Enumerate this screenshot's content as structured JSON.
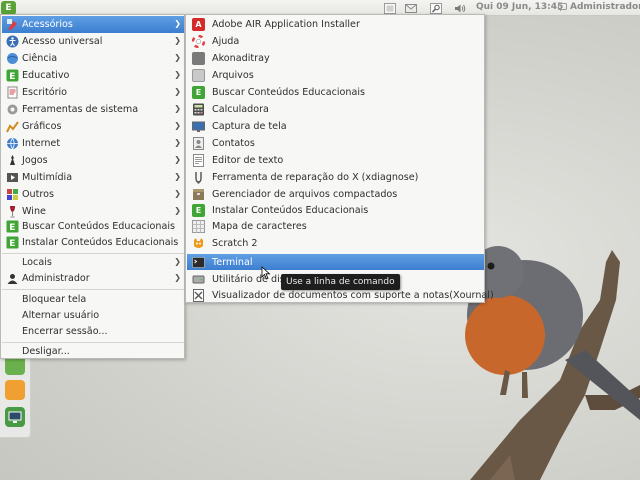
{
  "top_panel": {
    "menu_button_icon": "ubuntu-edu-menu-icon",
    "clock": "Qui 09 Jun, 13:45",
    "user": "Administrador",
    "tray_icons": [
      "workspace-icon",
      "mail-icon",
      "search-icon",
      "volume-icon"
    ]
  },
  "main_menu": {
    "categories": [
      {
        "label": "Acessórios",
        "icon": "accessories-icon",
        "selected": true
      },
      {
        "label": "Acesso universal",
        "icon": "universal-access-icon"
      },
      {
        "label": "Ciência",
        "icon": "science-icon"
      },
      {
        "label": "Educativo",
        "icon": "education-icon"
      },
      {
        "label": "Escritório",
        "icon": "office-icon"
      },
      {
        "label": "Ferramentas de sistema",
        "icon": "system-tools-icon"
      },
      {
        "label": "Gráficos",
        "icon": "graphics-icon"
      },
      {
        "label": "Internet",
        "icon": "internet-icon"
      },
      {
        "label": "Jogos",
        "icon": "games-icon"
      },
      {
        "label": "Multimídia",
        "icon": "multimedia-icon"
      },
      {
        "label": "Outros",
        "icon": "other-icon"
      },
      {
        "label": "Wine",
        "icon": "wine-icon"
      },
      {
        "label": "Buscar Conteúdos Educacionais",
        "icon": "edu-e-icon"
      },
      {
        "label": "Instalar Conteúdos Educacionais",
        "icon": "edu-e-icon"
      }
    ],
    "places": [
      {
        "label": "Locais"
      },
      {
        "label": "Administrador",
        "icon": "user-icon"
      }
    ],
    "session": [
      {
        "label": "Bloquear tela"
      },
      {
        "label": "Alternar usuário"
      },
      {
        "label": "Encerrar sessão..."
      }
    ],
    "shutdown": {
      "label": "Desligar..."
    }
  },
  "sub_menu": {
    "items": [
      {
        "label": "Adobe AIR Application Installer",
        "icon": "adobe-air-icon",
        "color": "#d42a2a"
      },
      {
        "label": "Ajuda",
        "icon": "help-lifebuoy-icon",
        "color": "#e04040"
      },
      {
        "label": "Akonaditray",
        "icon": "akonadi-icon",
        "color": "#7a7a7a"
      },
      {
        "label": "Arquivos",
        "icon": "files-icon",
        "color": "#9a9a9a"
      },
      {
        "label": "Buscar Conteúdos Educacionais",
        "icon": "edu-e-icon",
        "color": "#3fa535"
      },
      {
        "label": "Calculadora",
        "icon": "calculator-icon",
        "color": "#4d4d4d"
      },
      {
        "label": "Captura de tela",
        "icon": "screenshot-icon",
        "color": "#3b6fb0"
      },
      {
        "label": "Contatos",
        "icon": "contacts-icon",
        "color": "#8c8c8c"
      },
      {
        "label": "Editor de texto",
        "icon": "text-editor-icon",
        "color": "#7d7d7d"
      },
      {
        "label": "Ferramenta de reparação do X (xdiagnose)",
        "icon": "xdiagnose-icon",
        "color": "#5a5a5a"
      },
      {
        "label": "Gerenciador de arquivos compactados",
        "icon": "archive-manager-icon",
        "color": "#8a7a5a"
      },
      {
        "label": "Instalar Conteúdos Educacionais",
        "icon": "edu-e-icon",
        "color": "#3fa535"
      },
      {
        "label": "Mapa de caracteres",
        "icon": "character-map-icon",
        "color": "#9a9a9a"
      },
      {
        "label": "Scratch 2",
        "icon": "scratch-cat-icon",
        "color": "#f09a1c"
      },
      {
        "label": "Terminal",
        "icon": "terminal-icon",
        "color": "#2b2b2b",
        "selected": true
      },
      {
        "label": "Utilitário de disco",
        "icon": "disk-utility-icon",
        "color": "#8a8a8a"
      },
      {
        "label": "Visualizador de documentos com suporte a notas(Xournal)",
        "icon": "xournal-icon",
        "color": "#555555"
      }
    ]
  },
  "tooltip": "Use a linha de comando",
  "dock": {
    "icons": [
      "notes-icon",
      "folder-icon",
      "monitor-icon"
    ]
  }
}
